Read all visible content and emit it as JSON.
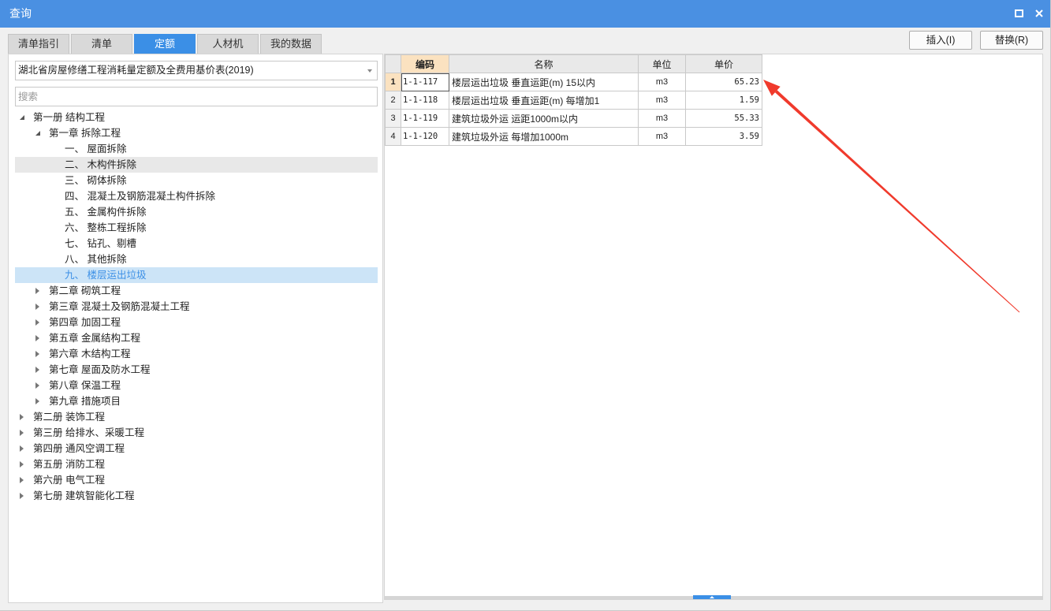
{
  "window": {
    "title": "查询"
  },
  "tabs": [
    {
      "label": "清单指引"
    },
    {
      "label": "清单"
    },
    {
      "label": "定额",
      "active": true
    },
    {
      "label": "人材机"
    },
    {
      "label": "我的数据"
    }
  ],
  "toolbar": {
    "insert_label": "插入(I)",
    "replace_label": "替换(R)"
  },
  "library_select": {
    "value": "湖北省房屋修缮工程消耗量定额及全费用基价表(2019)"
  },
  "search": {
    "placeholder": "搜索",
    "value": ""
  },
  "tree": [
    {
      "label": "第一册 结构工程",
      "expanded": true,
      "children": [
        {
          "label": "第一章 拆除工程",
          "expanded": true,
          "children": [
            {
              "label": "一、 屋面拆除"
            },
            {
              "label": "二、 木构件拆除",
              "hovered": true
            },
            {
              "label": "三、 砌体拆除"
            },
            {
              "label": "四、 混凝土及钢筋混凝土构件拆除"
            },
            {
              "label": "五、 金属构件拆除"
            },
            {
              "label": "六、 整栋工程拆除"
            },
            {
              "label": "七、 钻孔、剔槽"
            },
            {
              "label": "八、 其他拆除"
            },
            {
              "label": "九、 楼层运出垃圾",
              "selected": true
            }
          ]
        },
        {
          "label": "第二章 砌筑工程",
          "expanded": false
        },
        {
          "label": "第三章 混凝土及钢筋混凝土工程",
          "expanded": false
        },
        {
          "label": "第四章 加固工程",
          "expanded": false
        },
        {
          "label": "第五章 金属结构工程",
          "expanded": false
        },
        {
          "label": "第六章 木结构工程",
          "expanded": false
        },
        {
          "label": "第七章 屋面及防水工程",
          "expanded": false
        },
        {
          "label": "第八章 保温工程",
          "expanded": false
        },
        {
          "label": "第九章 措施项目",
          "expanded": false
        }
      ]
    },
    {
      "label": "第二册 装饰工程",
      "expanded": false
    },
    {
      "label": "第三册 给排水、采暖工程",
      "expanded": false
    },
    {
      "label": "第四册 通风空调工程",
      "expanded": false
    },
    {
      "label": "第五册 消防工程",
      "expanded": false
    },
    {
      "label": "第六册 电气工程",
      "expanded": false
    },
    {
      "label": "第七册 建筑智能化工程",
      "expanded": false
    }
  ],
  "table": {
    "headers": {
      "code": "编码",
      "name": "名称",
      "unit": "单位",
      "price": "单价"
    },
    "rows": [
      {
        "no": "1",
        "code": "1-1-117",
        "name": "楼层运出垃圾 垂直运距(m) 15以内",
        "unit": "m3",
        "price": "65.23",
        "current": true
      },
      {
        "no": "2",
        "code": "1-1-118",
        "name": "楼层运出垃圾 垂直运距(m) 每增加1",
        "unit": "m3",
        "price": "1.59"
      },
      {
        "no": "3",
        "code": "1-1-119",
        "name": "建筑垃圾外运 运距1000m以内",
        "unit": "m3",
        "price": "55.33"
      },
      {
        "no": "4",
        "code": "1-1-120",
        "name": "建筑垃圾外运 每增加1000m",
        "unit": "m3",
        "price": "3.59"
      }
    ]
  },
  "colors": {
    "title_bar": "#4a90e2",
    "accent": "#3b8fe6",
    "tree_selected_bg": "#cce4f7",
    "tree_hover_bg": "#e8e8e8",
    "header_highlight": "#fbe2c0",
    "annotation_arrow": "#f03a2c"
  },
  "icons": {
    "maximize": "maximize-icon",
    "close": "close-icon",
    "dropdown": "chevron-down-icon",
    "tree_expanded": "expanded-triangle-icon",
    "tree_collapsed": "collapsed-triangle-icon",
    "splitter": "chevron-up-icon"
  }
}
